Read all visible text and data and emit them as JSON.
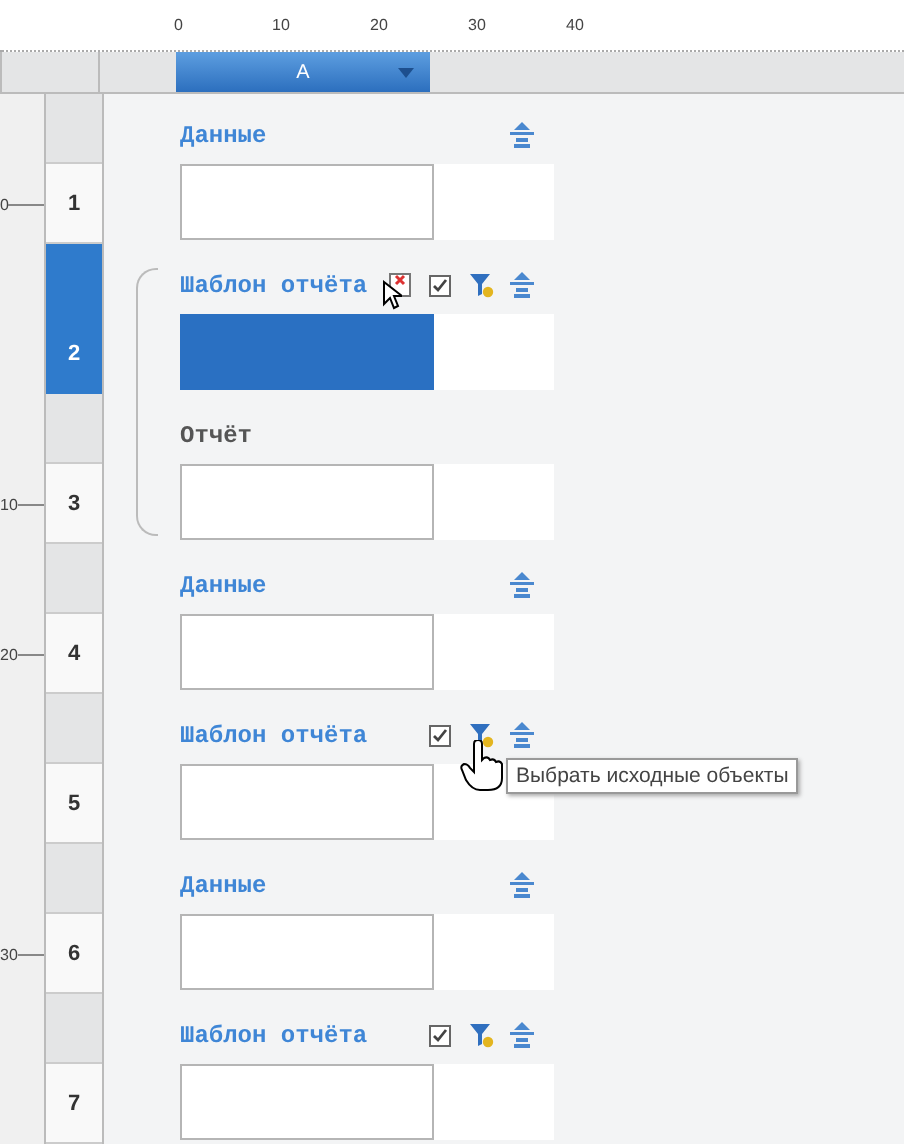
{
  "ruler": {
    "marks": [
      "0",
      "10",
      "20",
      "30",
      "40"
    ]
  },
  "columns": [
    {
      "label": "A",
      "selected": true
    }
  ],
  "rows": [
    {
      "kind": "row",
      "number": "1",
      "selected": false,
      "ruler_mark": "0",
      "label": {
        "text": "Данные",
        "kind": "link"
      },
      "icons": [
        {
          "kind": "collapse"
        }
      ]
    },
    {
      "kind": "group",
      "children": [
        {
          "number": "2",
          "selected": true,
          "label": {
            "text": "Шаблон отчёта",
            "kind": "link"
          },
          "icons": [
            {
              "kind": "remove"
            },
            {
              "kind": "checkbox"
            },
            {
              "kind": "filter"
            },
            {
              "kind": "collapse"
            }
          ],
          "pointer": {
            "kind": "arrow"
          }
        },
        {
          "number": "3",
          "selected": false,
          "ruler_mark": "10",
          "label": {
            "text": "Отчёт",
            "kind": "plain"
          }
        }
      ]
    },
    {
      "kind": "row",
      "number": "4",
      "selected": false,
      "ruler_mark": "20",
      "label": {
        "text": "Данные",
        "kind": "link"
      },
      "icons": [
        {
          "kind": "collapse"
        }
      ]
    },
    {
      "kind": "row",
      "number": "5",
      "selected": false,
      "label": {
        "text": "Шаблон отчёта",
        "kind": "link"
      },
      "icons": [
        {
          "kind": "checkbox"
        },
        {
          "kind": "filter"
        },
        {
          "kind": "collapse"
        }
      ],
      "pointer": {
        "kind": "hand"
      },
      "tooltip": "Выбрать исходные объекты"
    },
    {
      "kind": "row",
      "number": "6",
      "selected": false,
      "ruler_mark": "30",
      "label": {
        "text": "Данные",
        "kind": "link"
      },
      "icons": [
        {
          "kind": "collapse"
        }
      ]
    },
    {
      "kind": "row",
      "number": "7",
      "selected": false,
      "label": {
        "text": "Шаблон отчёта",
        "kind": "link"
      },
      "icons": [
        {
          "kind": "checkbox"
        },
        {
          "kind": "filter"
        },
        {
          "kind": "collapse"
        }
      ]
    }
  ]
}
